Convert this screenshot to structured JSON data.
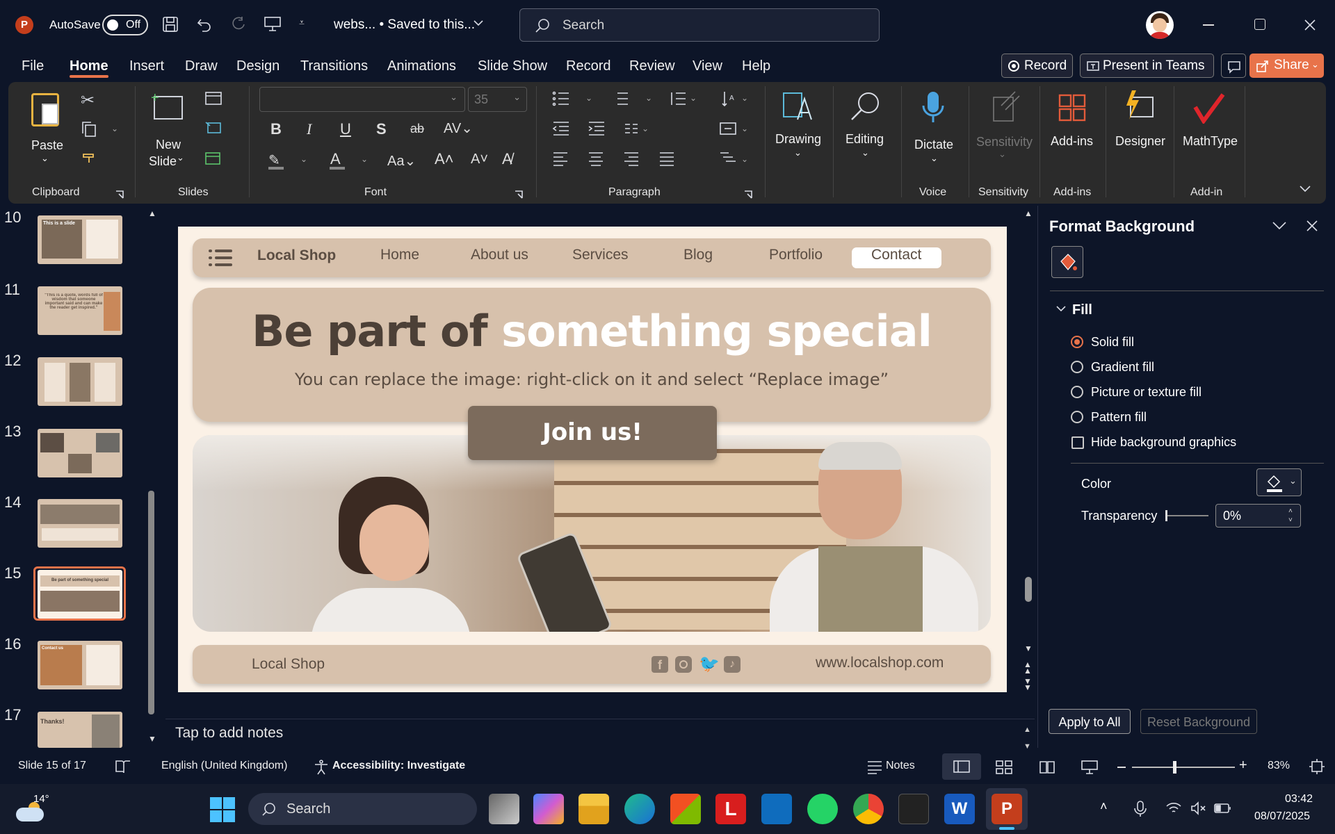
{
  "titlebar": {
    "autosave_label": "AutoSave",
    "autosave_state": "Off",
    "doc_title": "webs... • Saved to this...",
    "search_placeholder": "Search"
  },
  "tabs": [
    "File",
    "Home",
    "Insert",
    "Draw",
    "Design",
    "Transitions",
    "Animations",
    "Slide Show",
    "Record",
    "Review",
    "View",
    "Help"
  ],
  "actions": {
    "record": "Record",
    "present": "Present in Teams",
    "share": "Share"
  },
  "ribbon": {
    "paste": "Paste",
    "new_slide_1": "New",
    "new_slide_2": "Slide",
    "font_size": "35",
    "drawing": "Drawing",
    "editing": "Editing",
    "dictate": "Dictate",
    "sensitivity": "Sensitivity",
    "addins": "Add-ins",
    "designer": "Designer",
    "mathtype": "MathType",
    "groups": {
      "clipboard": "Clipboard",
      "slides": "Slides",
      "font": "Font",
      "paragraph": "Paragraph",
      "voice": "Voice",
      "sensitivity": "Sensitivity",
      "addins": "Add-ins",
      "addin": "Add-in"
    }
  },
  "thumbnails": {
    "numbers": [
      "10",
      "11",
      "12",
      "13",
      "14",
      "15",
      "16",
      "17"
    ],
    "current": "15",
    "t10": "This is a slide",
    "t11": "\"This is a quote, words full of wisdom that someone important said and can make the reader get inspired.\"",
    "t15": "Be part of something special",
    "t16": "Contact us",
    "t17": "Thanks!"
  },
  "slide": {
    "brand": "Local Shop",
    "nav": [
      "Home",
      "About us",
      "Services",
      "Blog",
      "Portfolio",
      "Contact"
    ],
    "headline_dark": "Be part of ",
    "headline_light": "something special",
    "subtitle": "You can replace the image: right-click on it and select “Replace image”",
    "cta": "Join us!",
    "footer_brand": "Local Shop",
    "footer_url": "www.localshop.com"
  },
  "notes": {
    "placeholder": "Tap to add notes"
  },
  "format_pane": {
    "title": "Format Background",
    "section": "Fill",
    "options": [
      "Solid fill",
      "Gradient fill",
      "Picture or texture fill",
      "Pattern fill"
    ],
    "selected": "Solid fill",
    "hide_graphics": "Hide background graphics",
    "color_label": "Color",
    "transparency_label": "Transparency",
    "transparency_value": "0%",
    "apply_all": "Apply to All",
    "reset": "Reset Background"
  },
  "statusbar": {
    "slide_info": "Slide 15 of 17",
    "language": "English (United Kingdom)",
    "accessibility": "Accessibility: Investigate",
    "notes": "Notes",
    "zoom": "83%"
  },
  "taskbar": {
    "weather": "14°",
    "search": "Search",
    "time": "03:42",
    "date": "08/07/2025"
  },
  "colors": {
    "accent": "#c43e1c",
    "slide_bg": "#fbf1e6",
    "tan": "#d7c1ac",
    "cta": "#7c6b5c"
  }
}
